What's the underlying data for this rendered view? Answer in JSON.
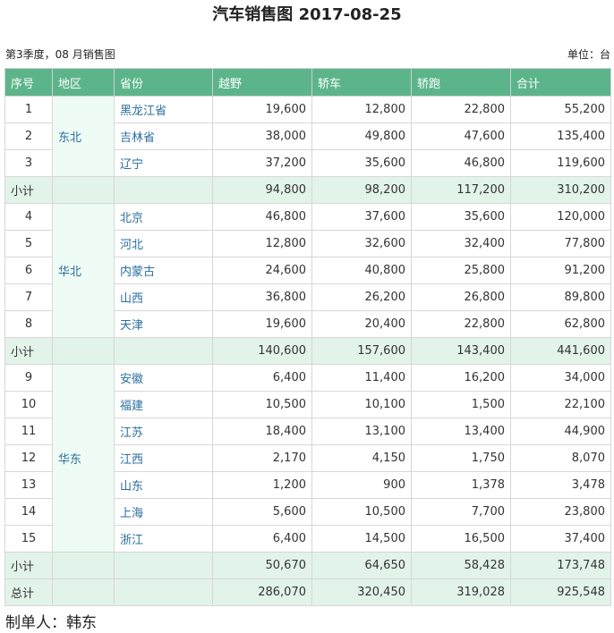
{
  "title": "汽车销售图 2017-08-25",
  "subtitle": "第3季度，08 月销售图",
  "unit": "单位：台",
  "headers": [
    "序号",
    "地区",
    "省份",
    "越野",
    "轿车",
    "轿跑",
    "合计"
  ],
  "groups": [
    {
      "region": "东北",
      "rows": [
        {
          "seq": "1",
          "province": "黑龙江省",
          "suv": "19,600",
          "sedan": "12,800",
          "coupe": "22,800",
          "total": "55,200"
        },
        {
          "seq": "2",
          "province": "吉林省",
          "suv": "38,000",
          "sedan": "49,800",
          "coupe": "47,600",
          "total": "135,400"
        },
        {
          "seq": "3",
          "province": "辽宁",
          "suv": "37,200",
          "sedan": "35,600",
          "coupe": "46,800",
          "total": "119,600"
        }
      ],
      "subtotal": {
        "label": "小计",
        "suv": "94,800",
        "sedan": "98,200",
        "coupe": "117,200",
        "total": "310,200"
      }
    },
    {
      "region": "华北",
      "rows": [
        {
          "seq": "4",
          "province": "北京",
          "suv": "46,800",
          "sedan": "37,600",
          "coupe": "35,600",
          "total": "120,000"
        },
        {
          "seq": "5",
          "province": "河北",
          "suv": "12,800",
          "sedan": "32,600",
          "coupe": "32,400",
          "total": "77,800"
        },
        {
          "seq": "6",
          "province": "内蒙古",
          "suv": "24,600",
          "sedan": "40,800",
          "coupe": "25,800",
          "total": "91,200"
        },
        {
          "seq": "7",
          "province": "山西",
          "suv": "36,800",
          "sedan": "26,200",
          "coupe": "26,800",
          "total": "89,800"
        },
        {
          "seq": "8",
          "province": "天津",
          "suv": "19,600",
          "sedan": "20,400",
          "coupe": "22,800",
          "total": "62,800"
        }
      ],
      "subtotal": {
        "label": "小计",
        "suv": "140,600",
        "sedan": "157,600",
        "coupe": "143,400",
        "total": "441,600"
      }
    },
    {
      "region": "华东",
      "rows": [
        {
          "seq": "9",
          "province": "安徽",
          "suv": "6,400",
          "sedan": "11,400",
          "coupe": "16,200",
          "total": "34,000"
        },
        {
          "seq": "10",
          "province": "福建",
          "suv": "10,500",
          "sedan": "10,100",
          "coupe": "1,500",
          "total": "22,100"
        },
        {
          "seq": "11",
          "province": "江苏",
          "suv": "18,400",
          "sedan": "13,100",
          "coupe": "13,400",
          "total": "44,900"
        },
        {
          "seq": "12",
          "province": "江西",
          "suv": "2,170",
          "sedan": "4,150",
          "coupe": "1,750",
          "total": "8,070"
        },
        {
          "seq": "13",
          "province": "山东",
          "suv": "1,200",
          "sedan": "900",
          "coupe": "1,378",
          "total": "3,478"
        },
        {
          "seq": "14",
          "province": "上海",
          "suv": "5,600",
          "sedan": "10,500",
          "coupe": "7,700",
          "total": "23,800"
        },
        {
          "seq": "15",
          "province": "浙江",
          "suv": "6,400",
          "sedan": "14,500",
          "coupe": "16,500",
          "total": "37,400"
        }
      ],
      "subtotal": {
        "label": "小计",
        "suv": "50,670",
        "sedan": "64,650",
        "coupe": "58,428",
        "total": "173,748"
      }
    }
  ],
  "grand_total": {
    "label": "总计",
    "suv": "286,070",
    "sedan": "320,450",
    "coupe": "319,028",
    "total": "925,548"
  },
  "author": "制单人：韩东"
}
